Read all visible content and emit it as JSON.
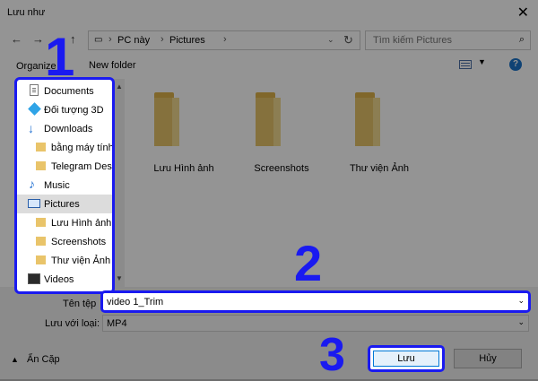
{
  "window": {
    "title": "Lưu như"
  },
  "breadcrumb": [
    "PC này",
    "Pictures"
  ],
  "search": {
    "placeholder": "Tìm kiếm Pictures"
  },
  "toolbar": {
    "organize": "Organize ▾",
    "new_folder": "New folder",
    "help": "?"
  },
  "sidebar": {
    "items": [
      {
        "label": "Documents",
        "icon": "documents-icon"
      },
      {
        "label": "Đối tượng 3D",
        "icon": "3d-objects-icon"
      },
      {
        "label": "Downloads",
        "icon": "downloads-icon"
      },
      {
        "label": "bằng máy tính",
        "icon": "folder-icon"
      },
      {
        "label": "Telegram Desk",
        "icon": "folder-icon"
      },
      {
        "label": "Music",
        "icon": "music-icon"
      },
      {
        "label": "Pictures",
        "icon": "pictures-icon",
        "selected": true
      },
      {
        "label": "Lưu Hình ảnh",
        "icon": "folder-icon"
      },
      {
        "label": "Screenshots",
        "icon": "folder-icon"
      },
      {
        "label": "Thư viện Ảnh",
        "icon": "folder-icon"
      },
      {
        "label": "Videos",
        "icon": "videos-icon"
      }
    ]
  },
  "folders": [
    {
      "label": "Lưu Hình ảnh"
    },
    {
      "label": "Screenshots"
    },
    {
      "label": "Thư viện Ảnh"
    }
  ],
  "form": {
    "filename_label": "Tên tệp",
    "filename_value": "video 1_Trim",
    "type_label": "Lưu với loại:",
    "type_value": "MP4"
  },
  "footer": {
    "hide_folders": "Ẩn Cặp",
    "save": "Lưu",
    "cancel": "Hủy"
  },
  "annotations": {
    "n1": "1",
    "n2": "2",
    "n3": "3"
  },
  "colors": {
    "annotation": "#1a1af0",
    "folder": "#e6c36a"
  }
}
